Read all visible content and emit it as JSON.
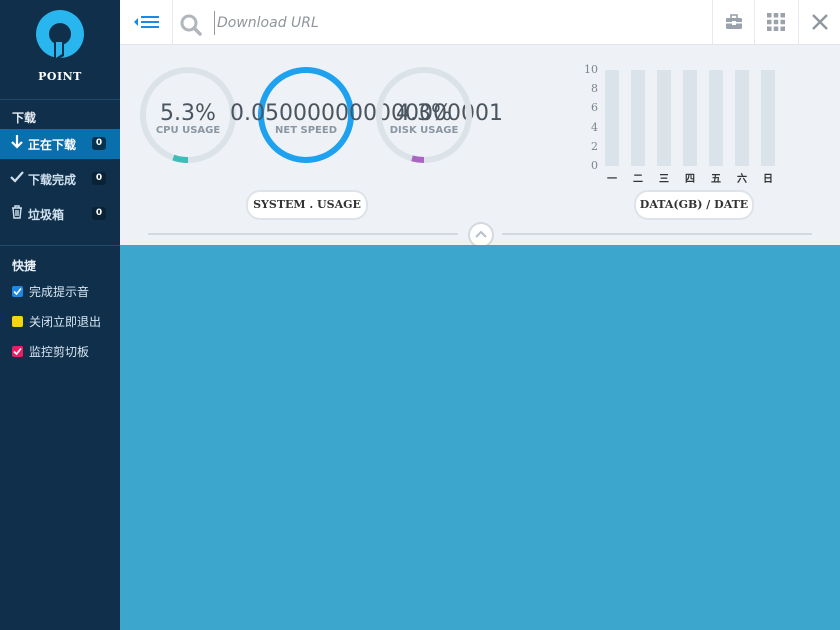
{
  "app": {
    "logo_text": "POINT"
  },
  "sidebar": {
    "downloads_title": "下载",
    "items": [
      {
        "label": "正在下载",
        "count": "0",
        "icon": "arrow-down-icon"
      },
      {
        "label": "下载完成",
        "count": "0",
        "icon": "check-icon"
      },
      {
        "label": "垃圾箱",
        "count": "0",
        "icon": "trash-icon"
      }
    ],
    "shortcuts_title": "快捷",
    "options": [
      {
        "label": "完成提示音",
        "color": "#1e88e5",
        "checked": true
      },
      {
        "label": "关闭立即退出",
        "color": "#f5d60a",
        "checked": false
      },
      {
        "label": "监控剪切板",
        "color": "#e91e63",
        "checked": true
      }
    ]
  },
  "topbar": {
    "search_placeholder": "Download URL",
    "buttons": [
      "toolbox-icon",
      "grid-icon",
      "close-icon"
    ]
  },
  "gauges": [
    {
      "value": "5.3%",
      "label": "CPU USAGE",
      "percent": 5.3,
      "color": "#3dbcb8"
    },
    {
      "value": "0.050000000000000001",
      "label": "NET SPEED",
      "percent": 100,
      "color": "#1ea1ef"
    },
    {
      "value": "4.3%",
      "label": "DISK USAGE",
      "percent": 4.3,
      "color": "#a965c2"
    }
  ],
  "system_usage_label": "SYSTEM . USAGE",
  "chart_data": {
    "type": "bar",
    "categories": [
      "一",
      "二",
      "三",
      "四",
      "五",
      "六",
      "日"
    ],
    "values": [
      0,
      0,
      0,
      0,
      0,
      0,
      0
    ],
    "ylim": [
      0,
      10
    ],
    "yticks": [
      "10",
      "8",
      "6",
      "4",
      "2",
      "0"
    ],
    "label": "DATA(GB) / DATE"
  }
}
